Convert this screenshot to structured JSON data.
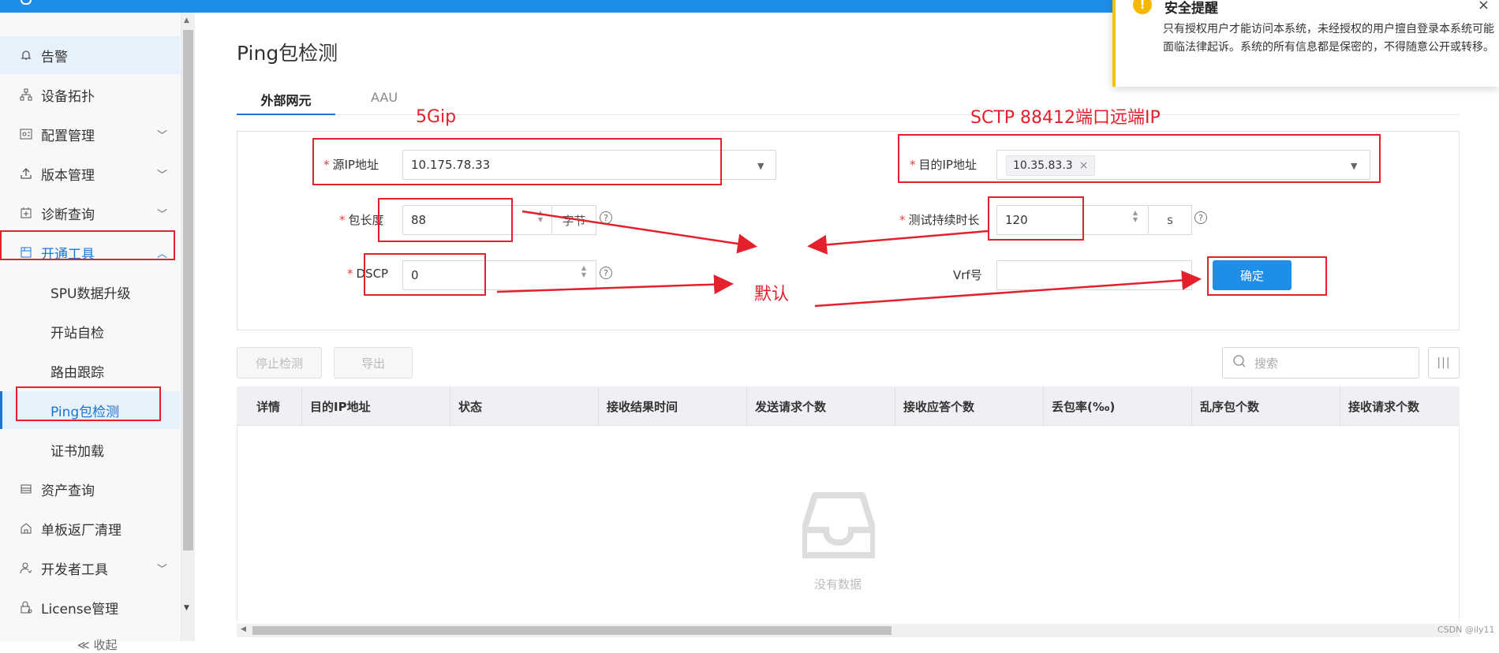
{
  "sidebar": {
    "items": [
      {
        "label": "告警",
        "icon": "bell-icon"
      },
      {
        "label": "设备拓扑",
        "icon": "topology-icon"
      },
      {
        "label": "配置管理",
        "icon": "config-icon"
      },
      {
        "label": "版本管理",
        "icon": "upload-icon"
      },
      {
        "label": "诊断查询",
        "icon": "diagnose-icon"
      },
      {
        "label": "开通工具",
        "icon": "tools-icon"
      },
      {
        "label": "资产查询",
        "icon": "asset-icon"
      },
      {
        "label": "单板返厂清理",
        "icon": "board-icon"
      },
      {
        "label": "开发者工具",
        "icon": "developer-icon"
      },
      {
        "label": "License管理",
        "icon": "license-icon"
      }
    ],
    "subitems": [
      "SPU数据升级",
      "开站自检",
      "路由跟踪",
      "Ping包检测",
      "证书加载"
    ],
    "collapse_label": "≪ 收起"
  },
  "page": {
    "title": "Ping包检测",
    "tabs": [
      "外部网元",
      "AAU"
    ]
  },
  "form": {
    "source_ip_label": "源IP地址",
    "source_ip_value": "10.175.78.33",
    "dest_ip_label": "目的IP地址",
    "dest_ip_tag": "10.35.83.3",
    "packet_length_label": "包长度",
    "packet_length_value": "88",
    "packet_length_unit": "字节",
    "duration_label": "测试持续时长",
    "duration_value": "120",
    "duration_unit": "s",
    "dscp_label": "DSCP",
    "dscp_value": "0",
    "vrf_label": "Vrf号",
    "vrf_value": "",
    "confirm_label": "确定"
  },
  "annotations": {
    "source_note": "5Gip",
    "dest_note": "SCTP 88412端口远端IP",
    "default_note": "默认"
  },
  "toolbar": {
    "stop_label": "停止检测",
    "export_label": "导出",
    "search_placeholder": "搜索"
  },
  "table": {
    "columns": [
      "详情",
      "目的IP地址",
      "状态",
      "接收结果时间",
      "发送请求个数",
      "接收应答个数",
      "丢包率(‰)",
      "乱序包个数",
      "接收请求个数"
    ],
    "empty_text": "没有数据"
  },
  "notification": {
    "title": "安全提醒",
    "body": "只有授权用户才能访问本系统，未经授权的用户擅自登录本系统可能面临法律起诉。系统的所有信息都是保密的，不得随意公开或转移。"
  },
  "watermark": "CSDN @ily11",
  "colors": {
    "accent": "#1f8ee9",
    "annotation": "#e3202b",
    "warning": "#f5b800"
  }
}
